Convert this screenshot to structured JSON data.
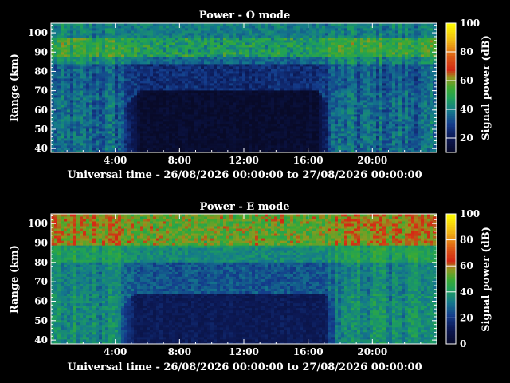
{
  "chart_data": [
    {
      "type": "heatmap",
      "title": "Power - O mode",
      "xlabel": "Universal time - 26/08/2026 00:00:00 to 27/08/2026 00:00:00",
      "ylabel": "Range (km)",
      "colorbar_label": "Signal power (dB)",
      "x_ticks": [
        "4:00",
        "8:00",
        "12:00",
        "16:00",
        "20:00"
      ],
      "x_tick_hours": [
        4,
        8,
        12,
        16,
        20
      ],
      "xlim_hours": [
        0,
        24
      ],
      "y_ticks": [
        40,
        50,
        60,
        70,
        80,
        90,
        100
      ],
      "ylim": [
        38,
        105
      ],
      "colorbar_ticks": [
        20,
        40,
        60,
        80,
        100
      ],
      "colorbar_range": [
        10,
        100
      ],
      "profile": {
        "dark_region_hours": [
          4.3,
          17.6
        ],
        "dark_region_top_km": 70,
        "blue_band_top_km": 84,
        "green_band_top_km": 93,
        "red_layer_km": [
          88,
          97
        ],
        "red_layer_db": 52
      }
    },
    {
      "type": "heatmap",
      "title": "Power - E mode",
      "xlabel": "Universal time - 26/08/2026 00:00:00 to 27/08/2026 00:00:00",
      "ylabel": "Range (km)",
      "colorbar_label": "Signal power (dB)",
      "x_ticks": [
        "4:00",
        "8:00",
        "12:00",
        "16:00",
        "20:00"
      ],
      "x_tick_hours": [
        4,
        8,
        12,
        16,
        20
      ],
      "xlim_hours": [
        0,
        24
      ],
      "y_ticks": [
        40,
        50,
        60,
        70,
        80,
        90,
        100
      ],
      "ylim": [
        38,
        105
      ],
      "colorbar_ticks": [
        0,
        20,
        40,
        60,
        80,
        100
      ],
      "colorbar_range": [
        0,
        100
      ],
      "profile": {
        "dark_region_hours": [
          4.0,
          18.0
        ],
        "dark_region_top_km": 64,
        "blue_band_top_km": 80,
        "green_band_top_km": 88,
        "red_layer_km": [
          89,
          105
        ],
        "red_layer_db": 58
      }
    }
  ]
}
